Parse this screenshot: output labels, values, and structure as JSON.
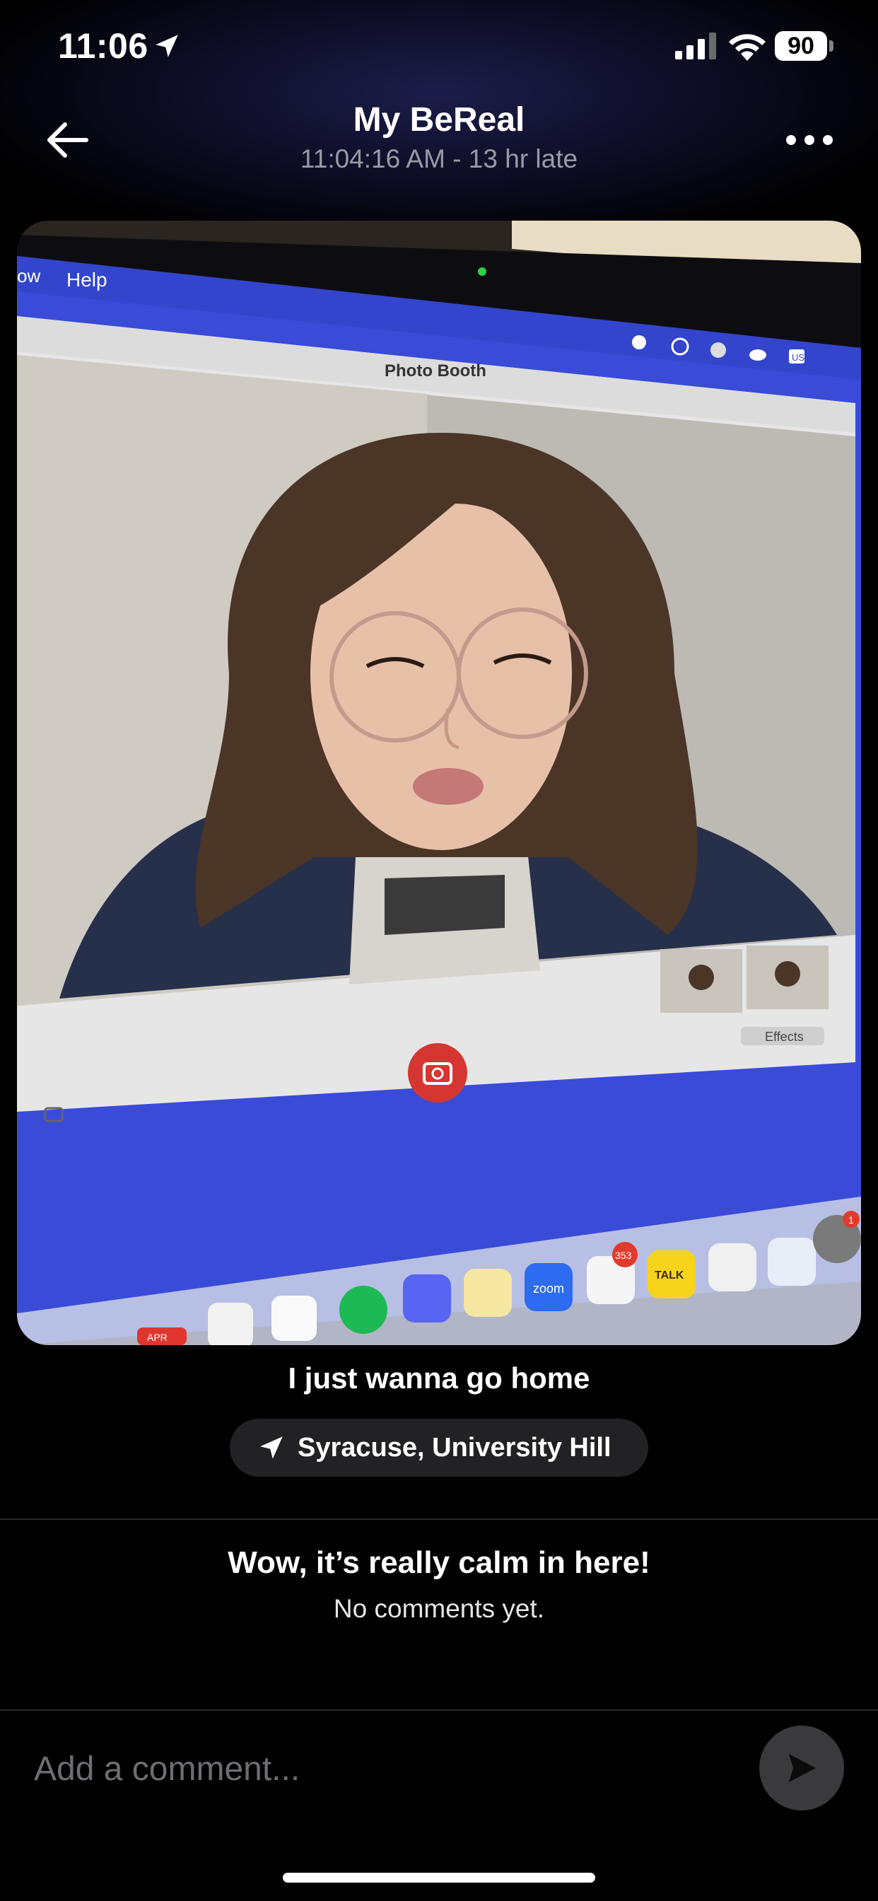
{
  "status_bar": {
    "time": "11:06",
    "battery": "90",
    "icons": [
      "location-arrow-icon",
      "signal-icon",
      "wifi-icon",
      "battery-icon"
    ]
  },
  "header": {
    "title": "My BeReal",
    "subtitle": "11:04:16 AM - 13 hr late",
    "back_icon": "arrow-left-icon",
    "more_icon": "ellipsis-icon"
  },
  "photo": {
    "menu_items": [
      "ow",
      "Help"
    ],
    "window_title": "Photo Booth",
    "effects_label": "Effects",
    "menu_badge": "US",
    "dock": {
      "date_label": "APR",
      "zoom_label": "zoom",
      "talk_label": "TALK",
      "outlook_badge": "353",
      "settings_badge": "1"
    }
  },
  "caption": "I just wanna go home",
  "location": {
    "icon": "location-arrow-icon",
    "text": "Syracuse, University Hill"
  },
  "comments": {
    "empty_title": "Wow, it’s really calm in here!",
    "empty_subtitle": "No comments yet."
  },
  "comment_box": {
    "placeholder": "Add a comment...",
    "send_icon": "send-icon"
  },
  "colors": {
    "background": "#000000",
    "pill": "#222224",
    "send_button": "#3a3a3c",
    "subtitle_gray": "#9a9aa6"
  }
}
